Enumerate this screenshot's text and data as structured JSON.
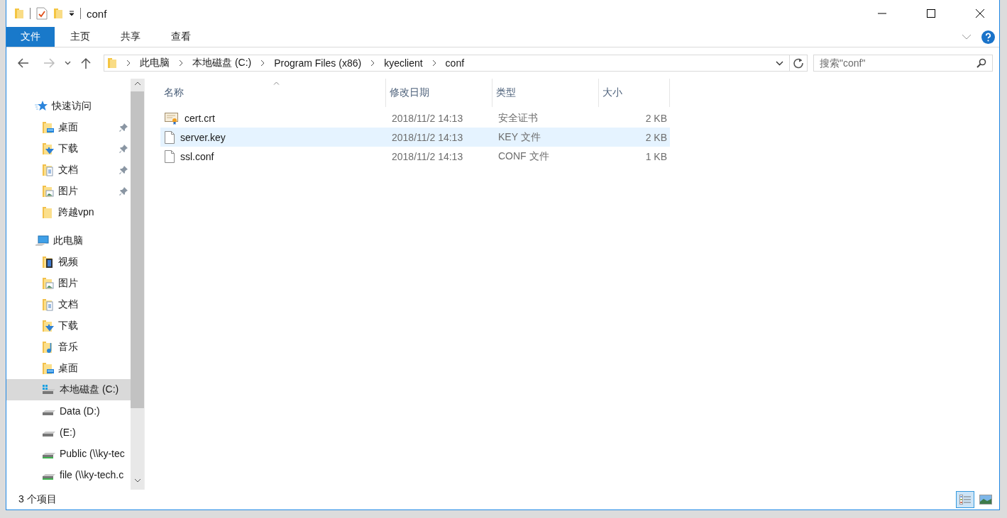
{
  "window": {
    "title": "conf"
  },
  "ribbon_tabs": [
    {
      "label": "文件",
      "selected": true
    },
    {
      "label": "主页",
      "selected": false
    },
    {
      "label": "共享",
      "selected": false
    },
    {
      "label": "查看",
      "selected": false
    }
  ],
  "address_bar": {
    "breadcrumbs": [
      "此电脑",
      "本地磁盘 (C:)",
      "Program Files (x86)",
      "kyeclient",
      "conf"
    ]
  },
  "search": {
    "placeholder": "搜索\"conf\""
  },
  "sidebar": {
    "groups": [
      {
        "label": "快速访问",
        "kind": "star",
        "selected": false,
        "children": [
          {
            "label": "桌面",
            "kind": "desktop",
            "pinned": true,
            "selected": false
          },
          {
            "label": "下载",
            "kind": "downloads",
            "pinned": true,
            "selected": false
          },
          {
            "label": "文档",
            "kind": "documents",
            "pinned": true,
            "selected": false
          },
          {
            "label": "图片",
            "kind": "pictures",
            "pinned": true,
            "selected": false
          },
          {
            "label": "跨越vpn",
            "kind": "folder",
            "pinned": false,
            "selected": false
          }
        ]
      },
      {
        "label": "此电脑",
        "kind": "computer",
        "selected": false,
        "children": [
          {
            "label": "视频",
            "kind": "videos",
            "pinned": false,
            "selected": false
          },
          {
            "label": "图片",
            "kind": "pictures",
            "pinned": false,
            "selected": false
          },
          {
            "label": "文档",
            "kind": "documents",
            "pinned": false,
            "selected": false
          },
          {
            "label": "下载",
            "kind": "downloads",
            "pinned": false,
            "selected": false
          },
          {
            "label": "音乐",
            "kind": "music",
            "pinned": false,
            "selected": false
          },
          {
            "label": "桌面",
            "kind": "desktop",
            "pinned": false,
            "selected": false
          },
          {
            "label": "本地磁盘 (C:)",
            "kind": "system-drive",
            "pinned": false,
            "selected": true
          },
          {
            "label": "Data (D:)",
            "kind": "drive",
            "pinned": false,
            "selected": false
          },
          {
            "label": " (E:)",
            "kind": "drive",
            "pinned": false,
            "selected": false
          },
          {
            "label": "Public (\\\\ky-tec",
            "kind": "network-drive",
            "pinned": false,
            "selected": false
          },
          {
            "label": "file (\\\\ky-tech.c",
            "kind": "network-drive",
            "pinned": false,
            "selected": false
          }
        ]
      }
    ]
  },
  "file_list": {
    "columns": [
      {
        "label": "名称",
        "sorted": true
      },
      {
        "label": "修改日期",
        "sorted": false
      },
      {
        "label": "类型",
        "sorted": false
      },
      {
        "label": "大小",
        "sorted": false
      }
    ],
    "rows": [
      {
        "name": "cert.crt",
        "kind": "certificate",
        "date": "2018/11/2 14:13",
        "type": "安全证书",
        "size": "2 KB",
        "selected": false
      },
      {
        "name": "server.key",
        "kind": "file",
        "date": "2018/11/2 14:13",
        "type": "KEY 文件",
        "size": "2 KB",
        "selected": true
      },
      {
        "name": "ssl.conf",
        "kind": "file",
        "date": "2018/11/2 14:13",
        "type": "CONF 文件",
        "size": "1 KB",
        "selected": false
      }
    ]
  },
  "status_bar": {
    "item_count": "3 个项目"
  },
  "view_buttons": [
    {
      "kind": "details",
      "selected": true
    },
    {
      "kind": "large-icons",
      "selected": false
    }
  ]
}
